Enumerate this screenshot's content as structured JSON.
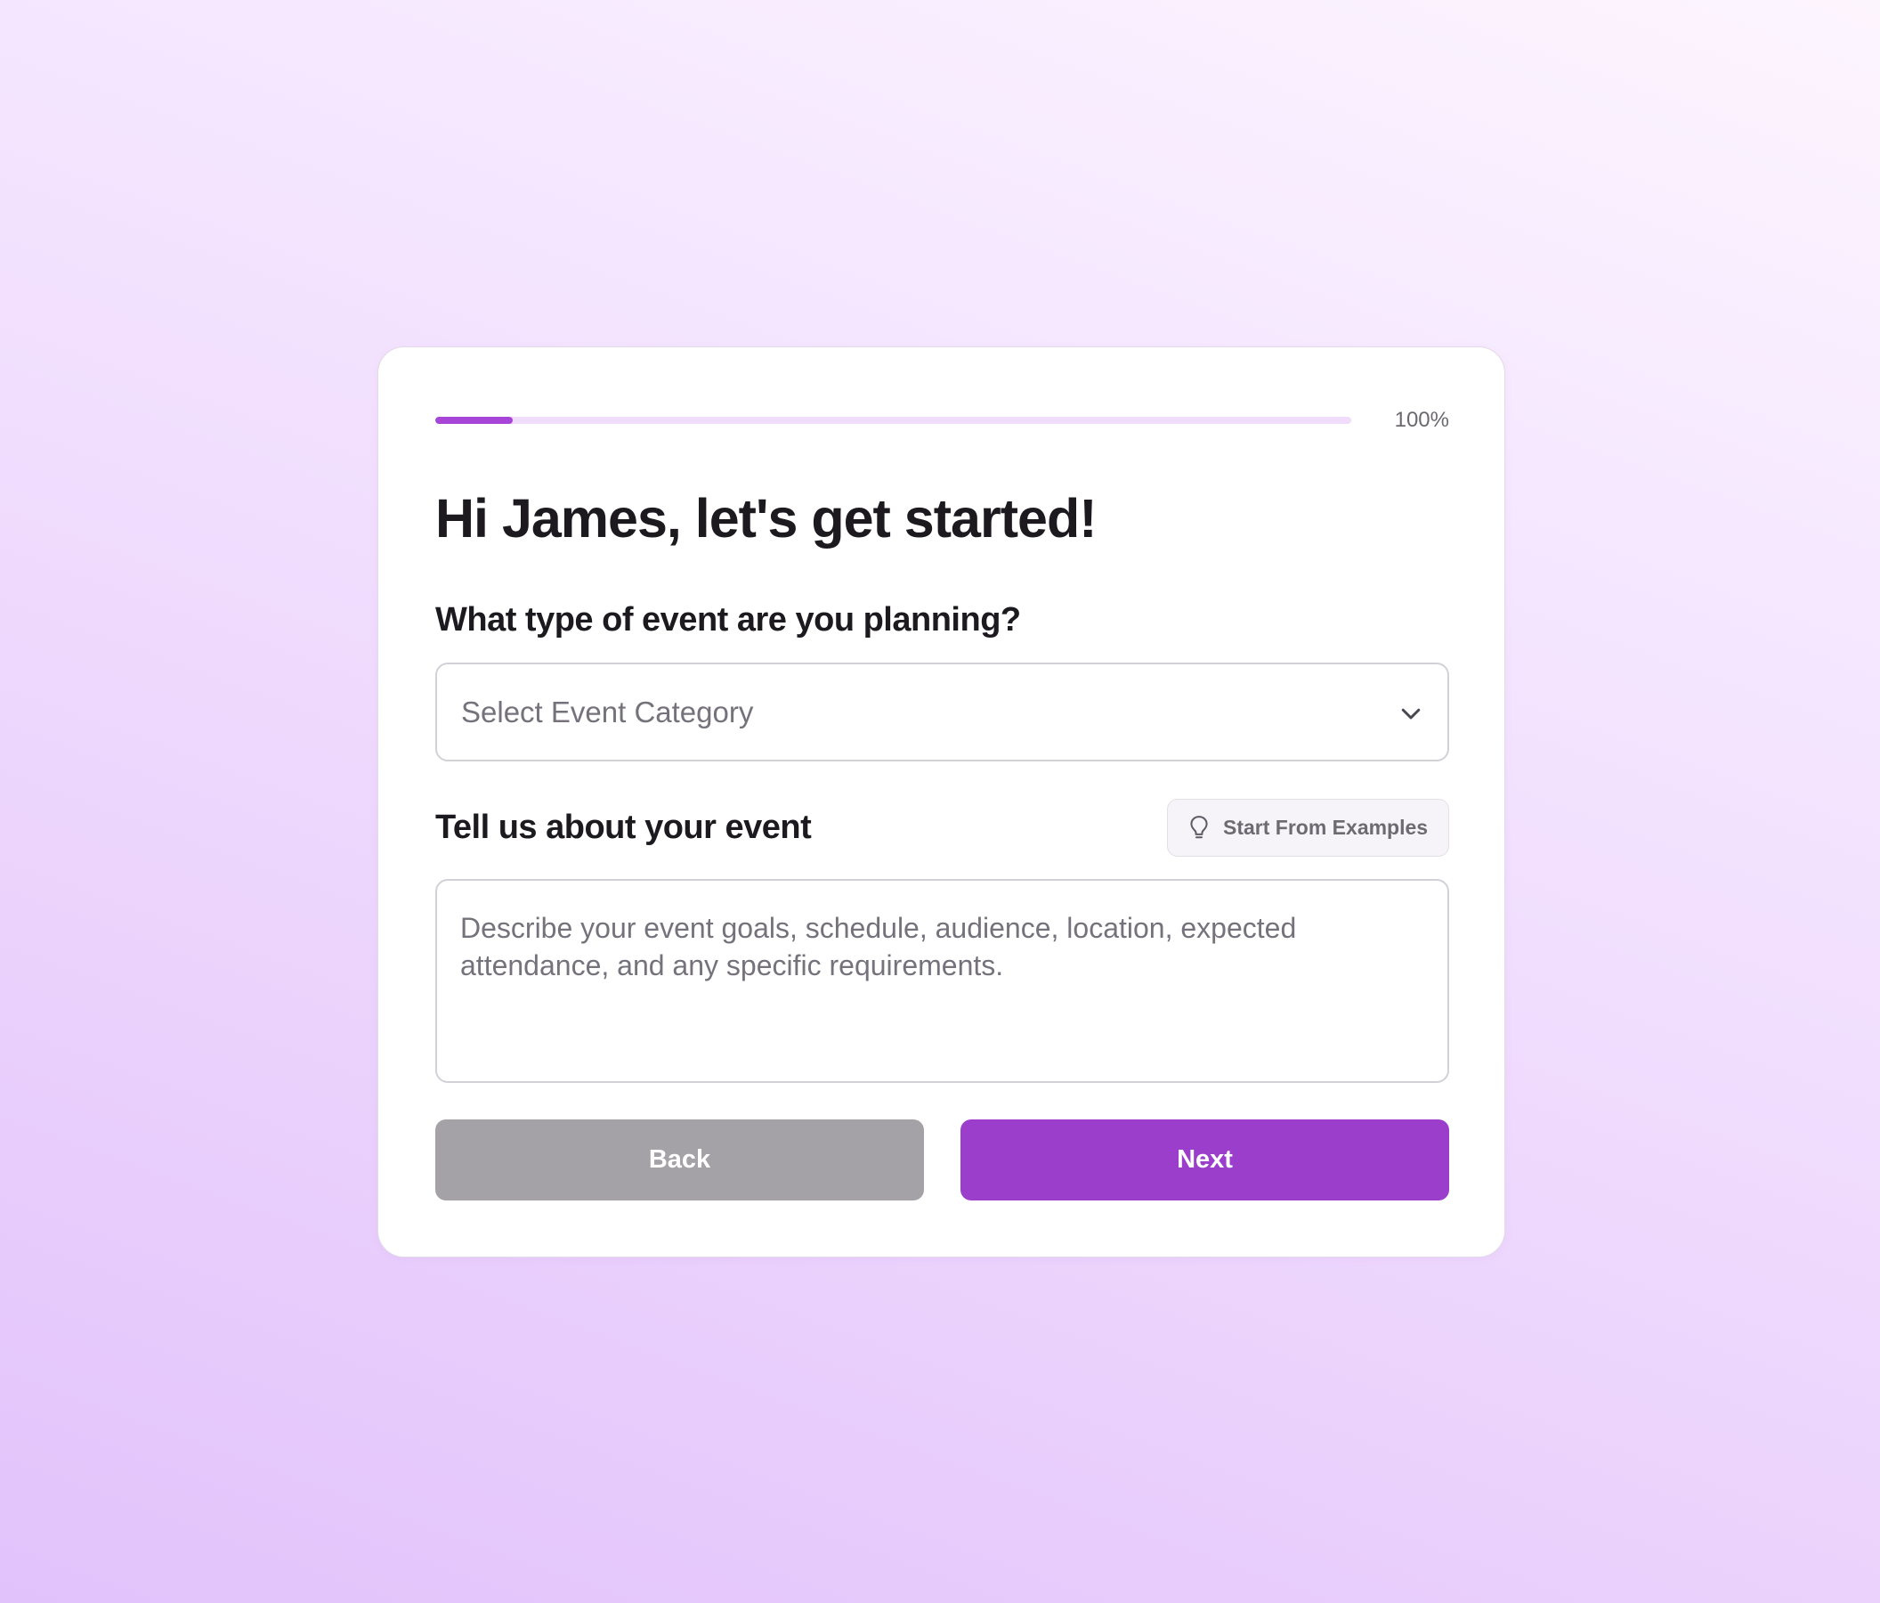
{
  "progress": {
    "label": "100%",
    "fraction": 0.085
  },
  "colors": {
    "accent": "#9a3ecb",
    "progress_fill": "#a645d8",
    "progress_track": "#f0dcfb",
    "back_button": "#a4a2a6"
  },
  "title": "Hi James, let's get started!",
  "event_type": {
    "question": "What type of event are you planning?",
    "placeholder": "Select Event Category",
    "icon": "chevron-down-icon"
  },
  "event_details": {
    "label": "Tell us about your event",
    "examples_button": "Start From Examples",
    "examples_icon": "lightbulb-icon",
    "placeholder": "Describe your event goals, schedule, audience, location, expected attendance, and any specific requirements."
  },
  "actions": {
    "back": "Back",
    "next": "Next"
  }
}
